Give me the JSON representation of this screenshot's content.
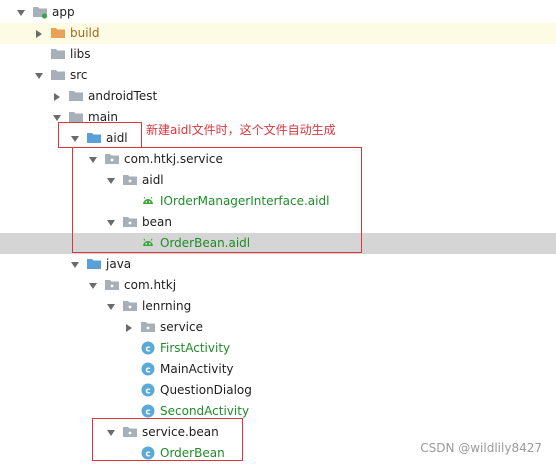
{
  "tree": [
    {
      "label": "app",
      "indent": 0,
      "arrow": "down",
      "icon": "module-folder-icon"
    },
    {
      "label": "build",
      "indent": 1,
      "arrow": "right",
      "icon": "orange-folder-icon",
      "text_color": "brown",
      "highlight": "yellow"
    },
    {
      "label": "libs",
      "indent": 1,
      "arrow": "none",
      "icon": "folder-icon"
    },
    {
      "label": "src",
      "indent": 1,
      "arrow": "down",
      "icon": "folder-icon"
    },
    {
      "label": "androidTest",
      "indent": 2,
      "arrow": "right",
      "icon": "folder-icon"
    },
    {
      "label": "main",
      "indent": 2,
      "arrow": "down",
      "icon": "folder-icon"
    },
    {
      "label": "aidl",
      "indent": 3,
      "arrow": "down",
      "icon": "blue-folder-icon"
    },
    {
      "label": "com.htkj.service",
      "indent": 4,
      "arrow": "down",
      "icon": "package-icon"
    },
    {
      "label": "aidl",
      "indent": 5,
      "arrow": "down",
      "icon": "package-icon"
    },
    {
      "label": "IOrderManagerInterface.aidl",
      "indent": 6,
      "arrow": "none",
      "icon": "android-icon",
      "text_color": "green"
    },
    {
      "label": "bean",
      "indent": 5,
      "arrow": "down",
      "icon": "package-icon"
    },
    {
      "label": "OrderBean.aidl",
      "indent": 6,
      "arrow": "none",
      "icon": "android-icon",
      "text_color": "green",
      "highlight": "gray"
    },
    {
      "label": "java",
      "indent": 3,
      "arrow": "down",
      "icon": "blue-folder-icon"
    },
    {
      "label": "com.htkj",
      "indent": 4,
      "arrow": "down",
      "icon": "package-icon"
    },
    {
      "label": "lenrning",
      "indent": 5,
      "arrow": "down",
      "icon": "package-icon"
    },
    {
      "label": "service",
      "indent": 6,
      "arrow": "right",
      "icon": "package-icon"
    },
    {
      "label": "FirstActivity",
      "indent": 6,
      "arrow": "none",
      "icon": "class-icon",
      "text_color": "green"
    },
    {
      "label": "MainActivity",
      "indent": 6,
      "arrow": "none",
      "icon": "class-icon"
    },
    {
      "label": "QuestionDialog",
      "indent": 6,
      "arrow": "none",
      "icon": "class-icon"
    },
    {
      "label": "SecondActivity",
      "indent": 6,
      "arrow": "none",
      "icon": "class-icon",
      "text_color": "green"
    },
    {
      "label": "service.bean",
      "indent": 5,
      "arrow": "down",
      "icon": "package-icon"
    },
    {
      "label": "OrderBean",
      "indent": 6,
      "arrow": "none",
      "icon": "class-icon",
      "text_color": "green"
    }
  ],
  "annotation": {
    "text": "新建aidl文件时，这个文件自动生成",
    "color": "#d9363e"
  },
  "watermark": "CSDN @wildlily8427",
  "colors": {
    "green_text": "#1f8c2a",
    "brown_text": "#9c6a1c",
    "highlight_gray": "#d5d5d5",
    "highlight_yellow": "#fdfbe3",
    "annotation_red": "#d9363e"
  }
}
